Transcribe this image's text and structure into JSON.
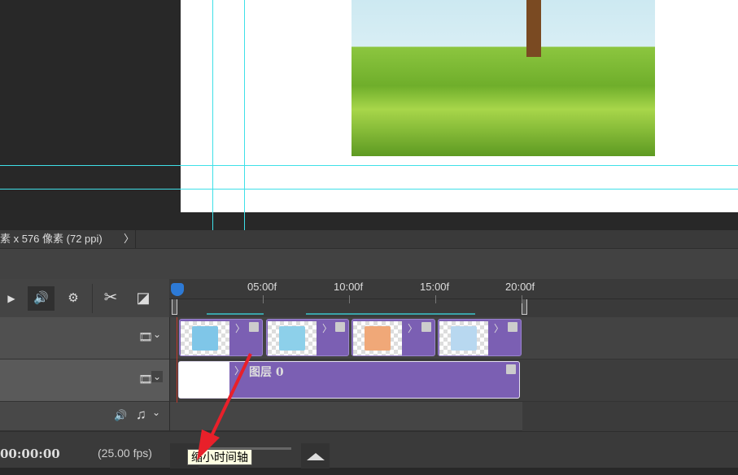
{
  "status": {
    "doc_info": "素 x 576 像素 (72 ppi)",
    "chevron": "〉"
  },
  "controls": {
    "play": "▶",
    "audio": "🔊",
    "settings": "⚙",
    "split": "✂",
    "transition": "◪"
  },
  "ruler": {
    "ticks": [
      "05:00f",
      "10:00f",
      "15:00f",
      "20:00f"
    ]
  },
  "tracks": {
    "video_group": {
      "clip_count": 4
    },
    "layer": {
      "name": "图层 0"
    },
    "film_icon": "🎞",
    "audio_icon": "🔊",
    "music_icon": "♫",
    "dropdown": "⌄"
  },
  "bottom": {
    "timecode": "00:00:00",
    "fps": "(25.00 fps)"
  },
  "tooltip": {
    "text": "缩小时间轴"
  },
  "colors": {
    "clip": "#7b5fb3",
    "guide": "#3fe0e8",
    "playhead": "#c0392b",
    "annotation_arrow": "#e8202a"
  }
}
